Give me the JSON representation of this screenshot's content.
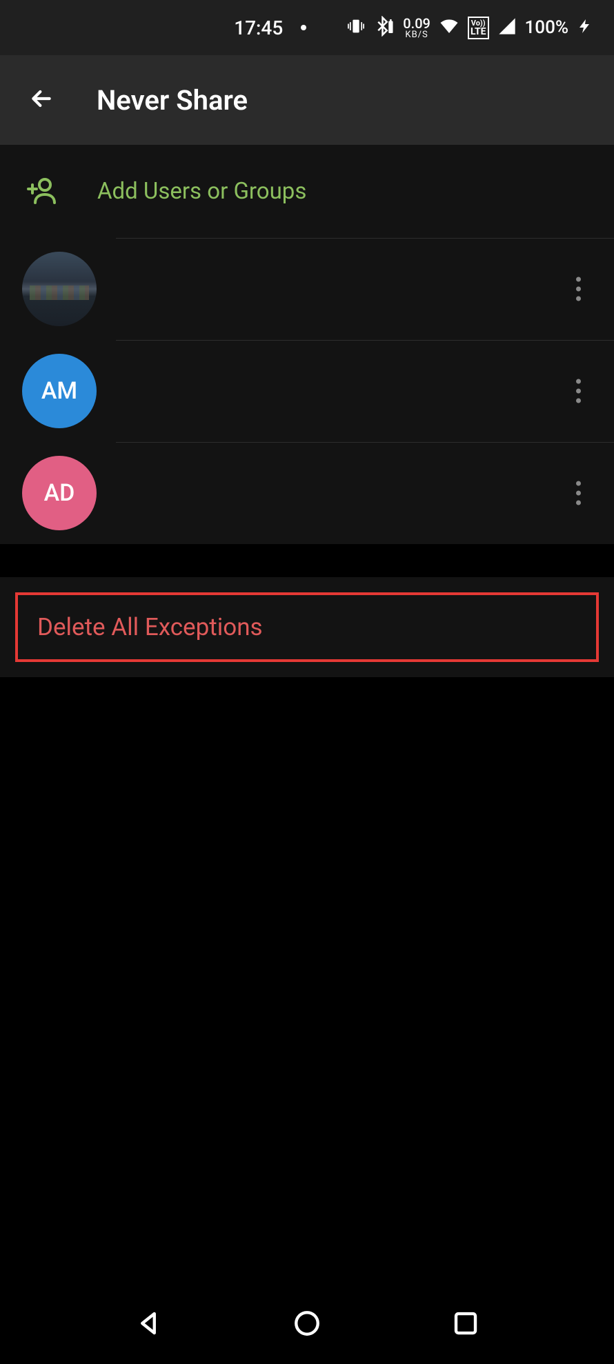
{
  "status": {
    "time": "17:45",
    "data_rate": "0.09",
    "data_unit": "KB/S",
    "volte_top": "Vo))",
    "volte_bottom": "LTE",
    "battery": "100%"
  },
  "header": {
    "title": "Never Share"
  },
  "add": {
    "label": "Add Users or Groups"
  },
  "contacts": [
    {
      "initials": "",
      "avatar_type": "image"
    },
    {
      "initials": "AM",
      "avatar_type": "am"
    },
    {
      "initials": "AD",
      "avatar_type": "ad"
    }
  ],
  "delete": {
    "label": "Delete All Exceptions"
  },
  "colors": {
    "accent_green": "#8cbf5e",
    "accent_red": "#e53935",
    "avatar_blue": "#2b8ad9",
    "avatar_pink": "#e15f84"
  }
}
